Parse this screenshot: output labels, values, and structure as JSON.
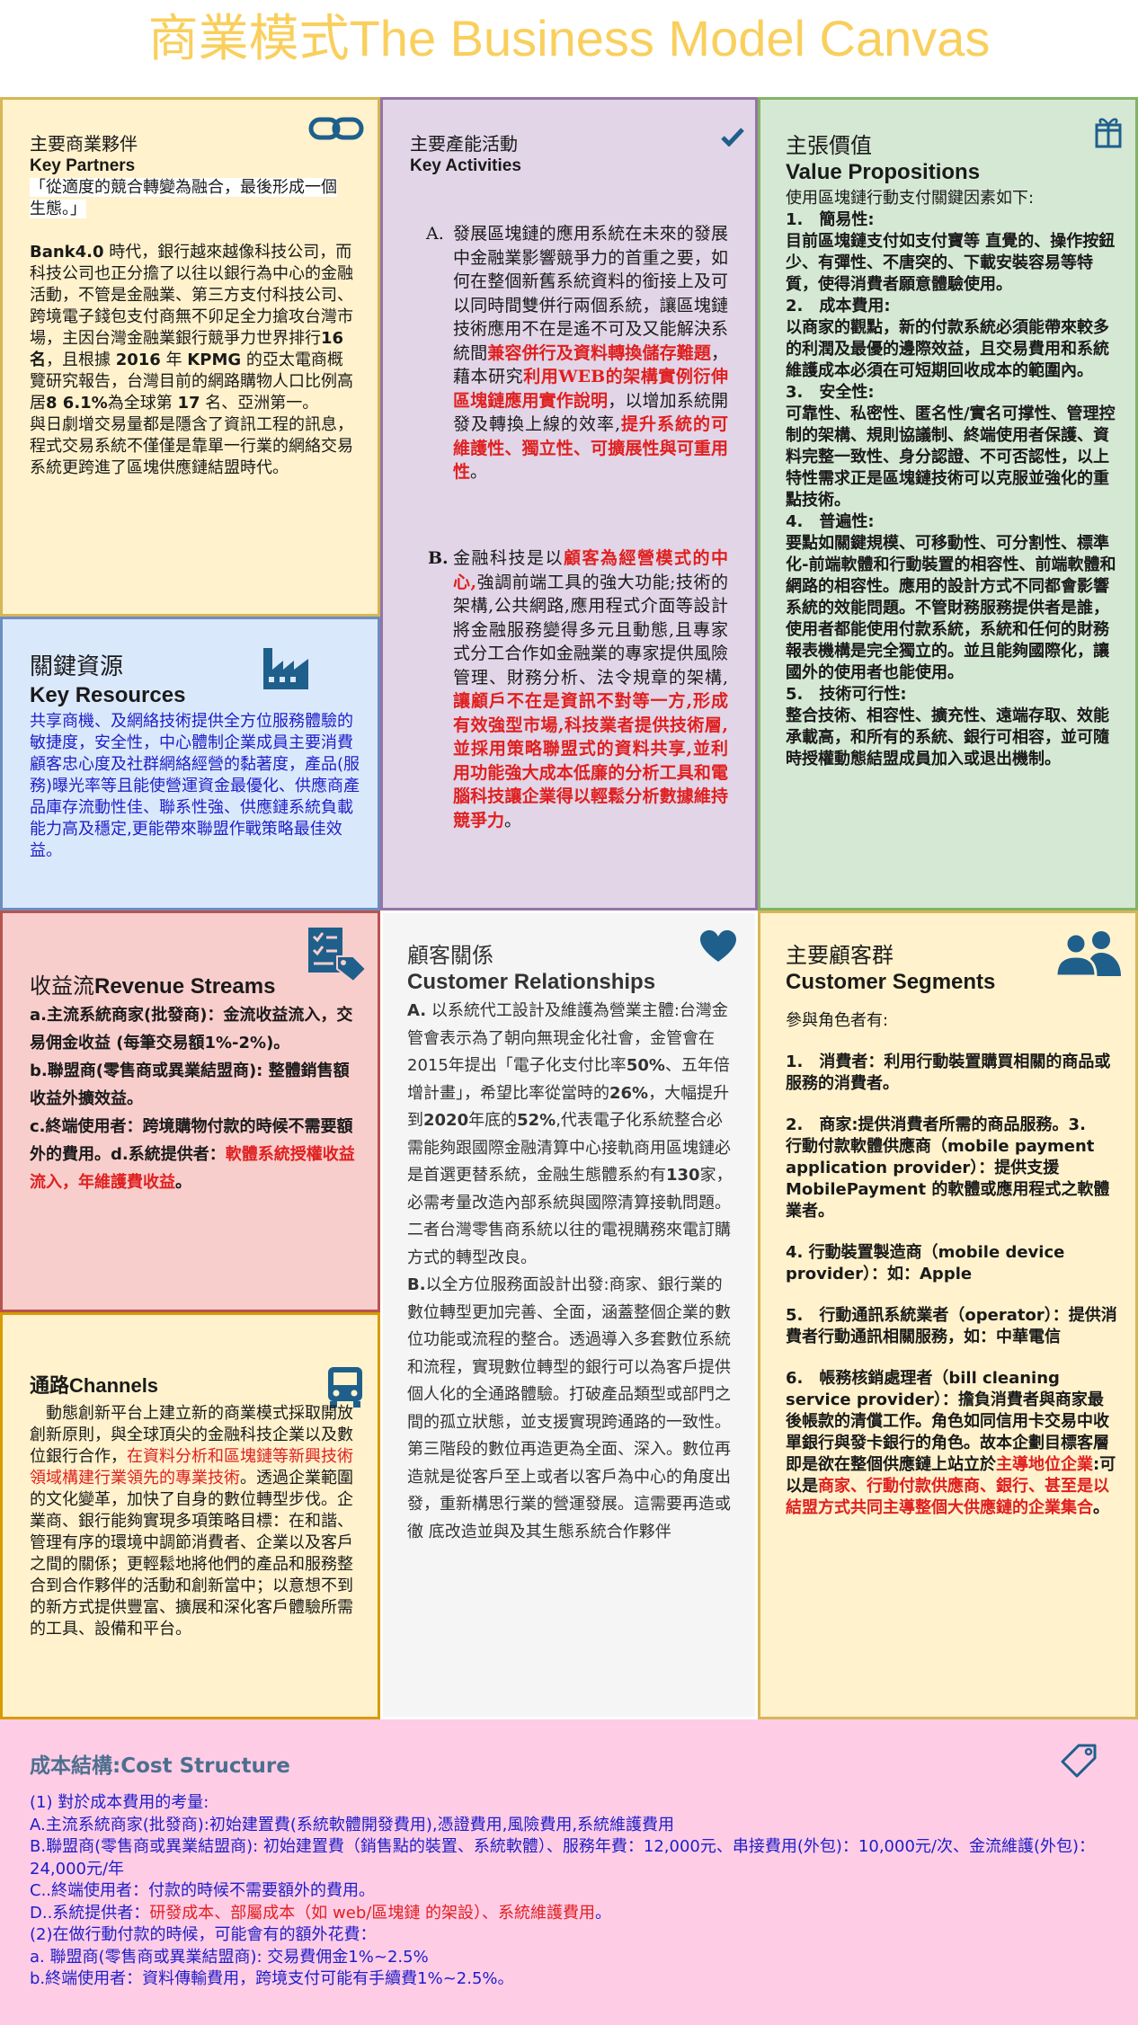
{
  "title": "商業模式The Business Model Canvas",
  "key_partners": {
    "title_zh": "主要商業夥伴",
    "title_en": "Key Partners",
    "quote": "「從適度的競合轉變為融合，最後形成一個生態。」",
    "body_1_a": "Bank4.0",
    "body_1_b": " 時代，銀行越來越像科技公司，而科技公司也正分擔了以往以銀行為中心的金融活動，不管是金融業、第三方支付科技公司、跨境電子錢包支付商無不卯足全力搶攻台灣市場，主因台灣金融業銀行競爭力世界排行",
    "body_1_c": "16名",
    "body_1_d": "，且根據 ",
    "body_1_e": "2016",
    "body_1_f": " 年 ",
    "body_1_g": "KPMG",
    "body_1_h": " 的亞太電商概覽研究報告，台灣目前的網路購物人口比例高居",
    "body_1_i": "8 6.1%",
    "body_1_j": "為全球第 ",
    "body_1_k": "17",
    "body_1_l": " 名、亞洲第一。",
    "body_2": "與日劇增交易量都是隱含了資訊工程的訊息，程式交易系統不僅僅是靠單一行業的網絡交易系統更跨進了區塊供應鏈結盟時代。",
    "icon": "link-icon"
  },
  "key_activities": {
    "title_zh": "主要產能活動",
    "title_en": "Key Activities",
    "a_marker": "A.",
    "a_1": "發展區塊鏈的應用系統在未來的發展中金融業影響競爭力的首重之要，如何在整個新舊系統資料的銜接上及可以同時間雙併行兩個系統，讓區塊鏈技術應用不在是遙不可及又能解決系統間",
    "a_2": "兼容併行及資料轉換儲存難題",
    "a_3": "，藉本研究",
    "a_4": "利用WEB的架構實例衍伸區塊鏈應用實作說明",
    "a_5": "，以增加系統開發及轉換上線的效率,",
    "a_6": "提升系統的可維護性、獨立性、可擴展性與可重用性",
    "a_7": "。",
    "b_marker": "B.",
    "b_1": "金融科技是以",
    "b_2": "顧客為經營模式的中心,",
    "b_3": "強調前端工具的強大功能;技術的架構,公共網路,應用程式介面等設計將金融服務變得多元且動態,且專家式分工合作如金融業的專家提供風險管理、財務分析、法令規章的架構,",
    "b_4": "讓顧戶不在是資訊不對等一方,形成有效強型市場,科技業者提供技術層,並採用策略聯盟式的資料共享,並利用功能強大成本低廉的分析工具和電腦科技讓企業得以輕鬆分析數據維持競爭力",
    "b_5": "。",
    "icon": "checkmark-icon"
  },
  "value_propositions": {
    "title_zh": "主張價值",
    "title_en": "Value Propositions",
    "intro": "使用區塊鏈行動支付關鍵因素如下:",
    "items": [
      {
        "num": "1.",
        "head": "簡易性:",
        "text": "目前區塊鏈支付如支付寶等 直覺的、操作按鈕少、有彈性、不唐突的、下載安裝容易等特質，使得消費者願意體驗使用。"
      },
      {
        "num": "2.",
        "head": "成本費用:",
        "text": "以商家的觀點，新的付款系統必須能帶來較多的利潤及最優的邊際效益，且交易費用和系統維護成本必須在可短期回收成本的範圍內。"
      },
      {
        "num": "3.",
        "head": "安全性:",
        "text": "可靠性、私密性、匿名性/實名可撑性、管理控制的架構、規則協議制、終端使用者保護、資料完整一致性、身分認證、不可否認性，以上特性需求正是區塊鏈技術可以克服並強化的重點技術。"
      },
      {
        "num": "4.",
        "head": "普遍性:",
        "text": "要點如關鍵規模、可移動性、可分割性、標準化-前端軟體和行動裝置的相容性、前端軟體和網路的相容性。應用的設計方式不同都會影響系統的效能問題。不管財務服務提供者是誰，使用者都能使用付款系統，系統和任何的財務報表機構是完全獨立的。並且能夠國際化，讓國外的使用者也能使用。"
      },
      {
        "num": "5.",
        "head": "技術可行性:",
        "text": "整合技術、相容性、擴充性、遠端存取、效能承載高，和所有的系統、銀行可相容，並可隨時授權動態結盟成員加入或退出機制。"
      }
    ],
    "icon": "gift-icon"
  },
  "key_resources": {
    "title_zh": "關鍵資源",
    "title_en": "Key Resources",
    "body": "共享商機、及網絡技術提供全方位服務體驗的敏捷度，安全性，中心體制企業成員主要消費顧客忠心度及社群網絡經營的黏著度，產品(服務)曝光率等且能使營運資金最優化、供應商產品庫存流動性佳、聯系性強、供應鏈系統負載能力高及穩定,更能帶來聯盟作戰策略最佳效益。",
    "icon": "factory-icon"
  },
  "revenue_streams": {
    "title_zh": "收益流",
    "title_en": "Revenue Streams",
    "a": "a.主流系統商家(批發商)：金流收益流入，交易佣金收益 (每筆交易額1%-2%)。",
    "b": "b.聯盟商(零售商或異業結盟商): 整體銷售額收益外擴效益。",
    "c": "c.終端使用者：跨境購物付款的時候不需要額外的費用。",
    "d_1": "d.系統提供者：",
    "d_2": "軟體系統授權收益流入，年維護費收益",
    "d_3": "。",
    "icon": "invoice-icon"
  },
  "channels": {
    "title_zh": "通路",
    "title_en": "Channels",
    "body_1": "　動態創新平台上建立新的商業模式採取開放創新原則，與全球頂尖的金融科技企業以及數位銀行合作，",
    "body_2": "在資料分析和區塊鏈等新興技術領域構建行業領先的專業技術",
    "body_3": "。透過企業範圍的文化變革，加快了自身的數位轉型步伐。企業商、銀行能夠實現多項策略目標：在和諧、管理有序的環境中調節消費者、企業以及客戶之間的關係；更輕鬆地將他們的產品和服務整合到合作夥伴的活動和創新當中；以意想不到的新方式提供豐富、擴展和深化客戶體驗所需的工具、設備和平台。",
    "icon": "truck-icon"
  },
  "customer_relationships": {
    "title_zh": "顧客關係",
    "title_en": "Customer Relationships",
    "a_1": "A.",
    "a_2": " 以系統代工設計及維護為營業主體:台灣金管會表示為了朝向無現金化社會，金管會在2015年提出「電子化支付比率",
    "a_3": "50%",
    "a_4": "、五年倍增計畫」，希望比率從當時的",
    "a_5": "26%",
    "a_6": "，大幅提升到",
    "a_7": "2020",
    "a_8": "年底的",
    "a_9": "52%",
    "a_10": ",代表電子化系統整合必需能夠跟國際金融清算中心接軌商用區塊鏈必是首選更替系統，金融生態體系約有",
    "a_11": "130",
    "a_12": "家，必需考量改造內部系統與國際清算接軌問題。二者台灣零售商系統以往的電視購務來電訂購方式的轉型改良。",
    "b_1": "B.",
    "b_2": "以全方位服務面設計出發:商家、銀行業的數位轉型更加完善、全面，涵蓋整個企業的數位功能或流程的整合。透過導入多套數位系統和流程，實現數位轉型的銀行可以為客戶提供個人化的全通路體驗。打破產品類型或部門之間的孤立狀態，並支援實現跨通路的一致性。 第三階段的數位再造更為全面、深入。數位再造就是從客戶至上或者以客戶為中心的角度出發，重新構思行業的營運發展。這需要再造或徹 底改造並與及其生態系統合作夥伴",
    "icon": "heart-icon"
  },
  "customer_segments": {
    "title_zh": "主要顧客群",
    "title_en": "Customer Segments",
    "intro": "參與角色者有:",
    "s1": "1.　消費者：利用行動裝置購買相關的商品或服務的消費者。",
    "s2": "2.　商家:提供消費者所需的商品服務。3.　行動付款軟體供應商（mobile payment application provider）：提供支援MobilePayment 的軟體或應用程式之軟體業者。",
    "s4": "4. 行動裝置製造商（mobile device provider）：如：Apple",
    "s5": "5.　行動通訊系統業者（operator）：提供消費者行動通訊相關服務，如：中華電信",
    "s6_1": "6.　帳務核銷處理者（bill cleaning service provider）：擔負消費者與商家最後帳款的清償工作。角色如同信用卡交易中收單銀行與發卡銀行的角色。故本企劃目標客層即是欲在整個供應鏈上站立於",
    "s6_2": "主導地位企業",
    "s6_3": ":可以是",
    "s6_4": "商家、行動付款供應商、銀行、甚至是以結盟方式共同主導整個大供應鏈的企業集合",
    "s6_5": "。",
    "icon": "users-icon"
  },
  "cost_structure": {
    "title": "成本結構:Cost Structure",
    "l1": "(1) 對於成本費用的考量:",
    "l2": "A.主流系統商家(批發商):初始建置費(系統軟體開發費用),憑證費用,風險費用,系統維護費用",
    "l3": "B.聯盟商(零售商或異業結盟商): 初始建置費（銷售點的裝置、系統軟體）、服務年費：12,000元、串接費用(外包)：10,000元/次、金流維護(外包)：24,000元/年",
    "l4": "C..終端使用者：付款的時候不需要額外的費用。",
    "l5_1": "D..系統提供者：",
    "l5_2": "研發成本、部屬成本（如 web/區塊鏈 的架設）、系統維護費用",
    "l5_3": "。",
    "l6": "(2)在做行動付款的時候，可能會有的額外花費：",
    "l7": "a. 聯盟商(零售商或異業結盟商): 交易費佣金1%~2.5%",
    "l8": "b.終端使用者：資料傳輸費用，跨境支付可能有手續費1%~2.5%。",
    "icon": "tag-icon"
  },
  "colors": {
    "title": "#f9cf5d",
    "key_partners_bg": "#fff2cc",
    "key_activities_bg": "#e1d5e7",
    "value_propositions_bg": "#d5e8d4",
    "key_resources_bg": "#dae8fc",
    "revenue_streams_bg": "#f8cecc",
    "channels_bg": "#fff2cc",
    "customer_relationships_bg": "#f5f5f5",
    "customer_segments_bg": "#fff2cc",
    "cost_structure_bg": "#ffcce6",
    "icon": "#1f5f8b",
    "highlight_red": "#e02020",
    "highlight_blue": "#1e1ec8"
  }
}
